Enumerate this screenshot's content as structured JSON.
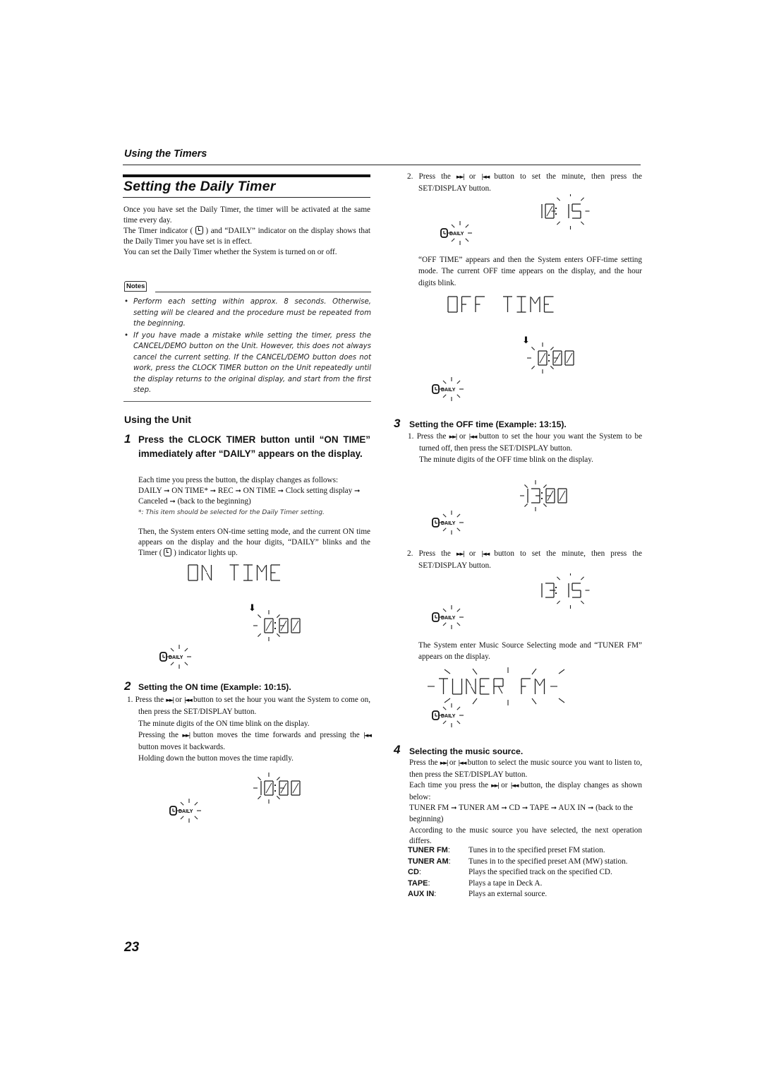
{
  "header": {
    "section_label": "Using the Timers",
    "title": "Setting the Daily Timer"
  },
  "intro": {
    "p1": "Once you have set the Daily Timer, the timer will be activated at the same time every day.",
    "p2_before_icon": "The Timer indicator (",
    "p2_after_icon": ") and “DAILY” indicator on the display shows that the Daily Timer you have set is in effect.",
    "p3": "You can set the Daily Timer whether the System is turned on or off."
  },
  "notes": {
    "label": "Notes",
    "items": [
      "Perform each setting within approx. 8 seconds. Otherwise, setting will be cleared and the procedure must be repeated from the beginning.",
      "If you have made a mistake while setting the timer, press the CANCEL/DEMO button on the Unit. However, this does not always cancel the current setting. If the CANCEL/DEMO button does not work, press the CLOCK TIMER button on the Unit repeatedly until the display returns to the original display, and start from the first step."
    ]
  },
  "using_unit": {
    "heading": "Using the Unit",
    "step1": {
      "number": "1",
      "title": "Press the CLOCK TIMER button until “ON TIME” immediately after “DAILY” appears on the display.",
      "desc": "Each time you press the button, the display changes as follows:",
      "sequence": [
        "DAILY",
        "ON TIME*",
        "REC",
        "ON TIME",
        "Clock setting display",
        "Canceled",
        "(back to the beginning)"
      ],
      "footnote": "*: This item should be selected for the Daily Timer setting.",
      "after_before_icon": "Then, the System enters ON-time setting mode, and the current ON time appears on the display and the hour digits, “DAILY” blinks and the Timer (",
      "after_after_icon": ") indicator lights up.",
      "display_text": "ON TIME",
      "display_time": "0:00"
    },
    "step2": {
      "number": "2",
      "title": "Setting the ON time (Example: 10:15).",
      "sub1_label": "1.",
      "sub1_a": "Press the",
      "sub1_b": "or",
      "sub1_c": "button to set the hour you want the System to come on, then press the SET/DISPLAY button.",
      "sub1_line2": "The minute digits of the ON time blink on the display.",
      "sub1_line3a": "Pressing the",
      "sub1_line3b": "button moves the time forwards and pressing the",
      "sub1_line3c": "button moves it backwards.",
      "sub1_line4": "Holding down the button moves the time rapidly.",
      "display_time": "10:00",
      "sub2_label": "2.",
      "sub2_a": "Press the",
      "sub2_b": "or",
      "sub2_c": "button to set the minute, then press the SET/DISPLAY button.",
      "display_time2": "10:15",
      "after": "“OFF TIME” appears and then the System enters OFF-time setting mode. The current OFF time appears on the display, and the hour digits blink.",
      "display_text_off": "OFF TIME",
      "display_time_off": "0:00"
    },
    "step3": {
      "number": "3",
      "title": "Setting the OFF time (Example: 13:15).",
      "sub1_label": "1.",
      "sub1_a": "Press the",
      "sub1_b": "or",
      "sub1_c": "button to set the hour you want the System to be turned off, then press the SET/DISPLAY button.",
      "sub1_line2": "The minute digits of the OFF time blink on the display.",
      "display_time": "13:00",
      "sub2_label": "2.",
      "sub2_a": "Press the",
      "sub2_b": "or",
      "sub2_c": "button to set the minute, then press the SET/DISPLAY button.",
      "display_time2": "13:15",
      "after": "The System enter Music Source Selecting mode and “TUNER FM” appears on the display.",
      "display_text_src": "TUNER FM"
    },
    "step4": {
      "number": "4",
      "title": "Selecting the music source.",
      "p1a": "Press the",
      "p1b": "or",
      "p1c": "button to select the music source you want to listen to, then press the SET/DISPLAY button.",
      "p2a": "Each time you press the",
      "p2b": "or",
      "p2c": "button, the display changes as shown below:",
      "sequence": [
        "TUNER FM",
        "TUNER AM",
        "CD",
        "TAPE",
        "AUX IN",
        "(back to the beginning)"
      ],
      "p3": "According to the music source you have selected, the next operation differs.",
      "sources": [
        {
          "key": "TUNER FM",
          "desc": "Tunes in to the specified preset FM station."
        },
        {
          "key": "TUNER AM",
          "desc": "Tunes in to the specified preset AM (MW) station."
        },
        {
          "key": "CD",
          "desc": "Plays the specified track on the specified CD."
        },
        {
          "key": "TAPE",
          "desc": "Plays a tape in Deck A."
        },
        {
          "key": "AUX IN",
          "desc": "Plays an external source."
        }
      ]
    }
  },
  "indicators": {
    "daily_label": "DAILY",
    "fwd_glyph": "►►|",
    "back_glyph": "|◄◄",
    "arrow_glyph": "➞",
    "down_arrow": "⬇"
  },
  "footer": {
    "page_number": "23"
  }
}
